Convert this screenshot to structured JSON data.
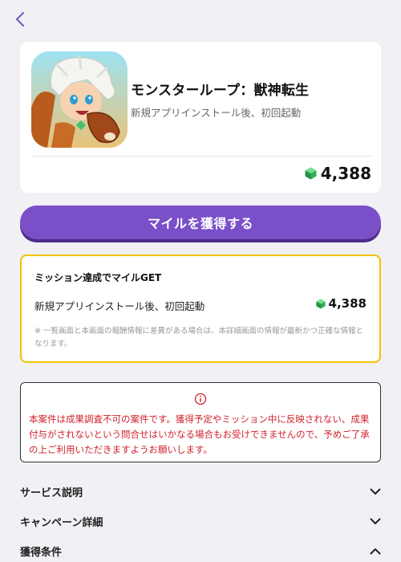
{
  "nav": {
    "back_icon": "chevron-left-icon",
    "accent": "#7a5cc8"
  },
  "app": {
    "title": "モンスターループ：獣神転生",
    "subtitle": "新規アプリインストール後、初回起動",
    "reward": "4,388",
    "icon": "app-icon"
  },
  "cta": {
    "label": "マイルを獲得する",
    "color": "#7a4fc8"
  },
  "mission": {
    "title": "ミッション達成でマイルGET",
    "item_label": "新規アプリインストール後、初回起動",
    "item_reward": "4,388",
    "note": "※ 一覧画面と本画面の報酬情報に差異がある場合は、本詳細画面の情報が最新かつ正確な情報となります。",
    "border_color": "#f2c200"
  },
  "warning": {
    "icon": "info-icon",
    "text": "本案件は成果調査不可の案件です。獲得予定やミッション中に反映されない、成果付与がされないという問合せはいかなる場合もお受けできませんので、予めご了承の上ご利用いただきますようお願いします。",
    "color": "#d2222d"
  },
  "accordions": [
    {
      "label": "サービス説明",
      "state": "collapsed"
    },
    {
      "label": "キャンペーン詳細",
      "state": "collapsed"
    },
    {
      "label": "獲得条件",
      "state": "expanded"
    }
  ]
}
